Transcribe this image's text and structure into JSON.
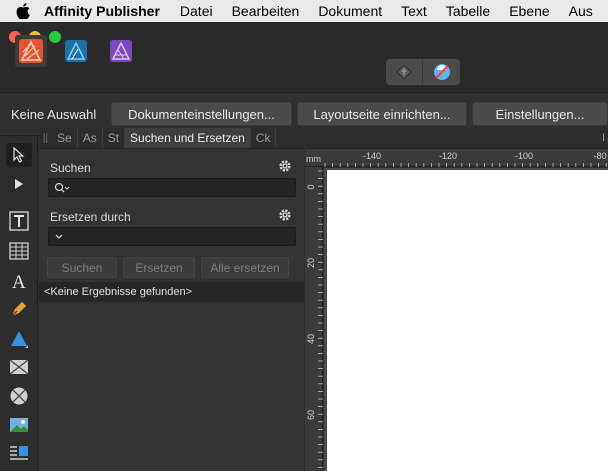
{
  "menubar": {
    "app_name": "Affinity Publisher",
    "items": [
      "Datei",
      "Bearbeiten",
      "Dokument",
      "Text",
      "Tabelle",
      "Ebene",
      "Aus"
    ]
  },
  "studio": {
    "apps": [
      "Affinity Publisher",
      "Affinity Designer",
      "Affinity Photo"
    ],
    "colors": {
      "publisher": "#e8532f",
      "designer": "#1b9ad6",
      "photo": "#8b5bd1"
    }
  },
  "context_bar": {
    "label": "Keine Auswahl",
    "buttons": [
      "Dokumenteinstellungen...",
      "Layoutseite einrichten...",
      "Einstellungen..."
    ]
  },
  "tools": [
    "move-tool",
    "node-tool",
    "frame-text-tool",
    "table-tool",
    "artistic-text-tool",
    "pen-tool",
    "shape-tool",
    "picture-frame-tool",
    "ellipse-frame-tool",
    "place-image-tool",
    "text-wrap-tool"
  ],
  "panel": {
    "tabs": [
      "Se",
      "As",
      "St",
      "Suchen und Ersetzen",
      "Ck"
    ],
    "search_label": "Suchen",
    "replace_label": "Ersetzen durch",
    "buttons": {
      "find": "Suchen",
      "replace": "Ersetzen",
      "replace_all": "Alle ersetzen"
    },
    "results_text": "<Keine Ergebnisse gefunden>"
  },
  "ruler": {
    "unit": "mm",
    "h_labels": [
      "-140",
      "-120",
      "-100",
      "-80"
    ],
    "v_labels": [
      "0",
      "20",
      "40",
      "60"
    ],
    "corner_fragment": "I"
  }
}
